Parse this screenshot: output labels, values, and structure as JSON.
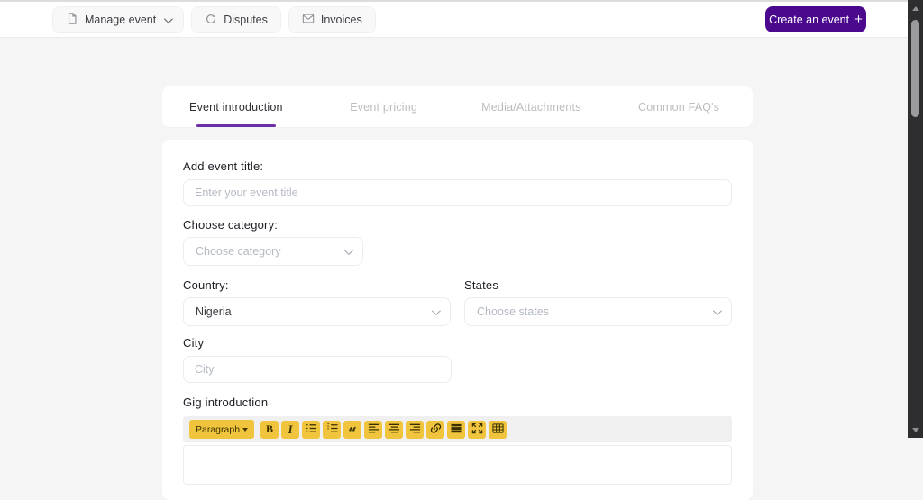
{
  "header": {
    "nav": [
      {
        "label": "Manage event",
        "icon": "file-icon",
        "has_dropdown": true
      },
      {
        "label": "Disputes",
        "icon": "refresh-icon"
      },
      {
        "label": "Invoices",
        "icon": "envelope-icon"
      }
    ],
    "create_event": {
      "label": "Create an event",
      "plus": "+"
    }
  },
  "tabs": [
    {
      "label": "Event introduction",
      "active": true
    },
    {
      "label": "Event pricing",
      "active": false
    },
    {
      "label": "Media/Attachments",
      "active": false
    },
    {
      "label": "Common FAQ's",
      "active": false
    }
  ],
  "form": {
    "event_title": {
      "label": "Add event title:",
      "placeholder": "Enter your event title",
      "value": ""
    },
    "category": {
      "label": "Choose category:",
      "placeholder": "Choose category",
      "value": ""
    },
    "country": {
      "label": "Country:",
      "value": "Nigeria"
    },
    "states": {
      "label": "States",
      "placeholder": "Choose states",
      "value": ""
    },
    "city": {
      "label": "City",
      "placeholder": "City",
      "value": ""
    },
    "gig_introduction": {
      "label": "Gig introduction",
      "toolbar": {
        "block_format": "Paragraph",
        "bold_glyph": "B",
        "italic_glyph": "I",
        "quote_glyph": "“",
        "icons": [
          "paragraph-dropdown",
          "bold",
          "italic",
          "bullet-list",
          "ordered-list",
          "blockquote",
          "align-left",
          "align-center",
          "align-right",
          "link",
          "horizontal-rule",
          "fullscreen",
          "table"
        ]
      },
      "content": ""
    }
  },
  "colors": {
    "accent-purple": "#4b0a8d",
    "tab-underline": "#6b2fa8",
    "toolbar-highlight": "#f0c53d"
  }
}
